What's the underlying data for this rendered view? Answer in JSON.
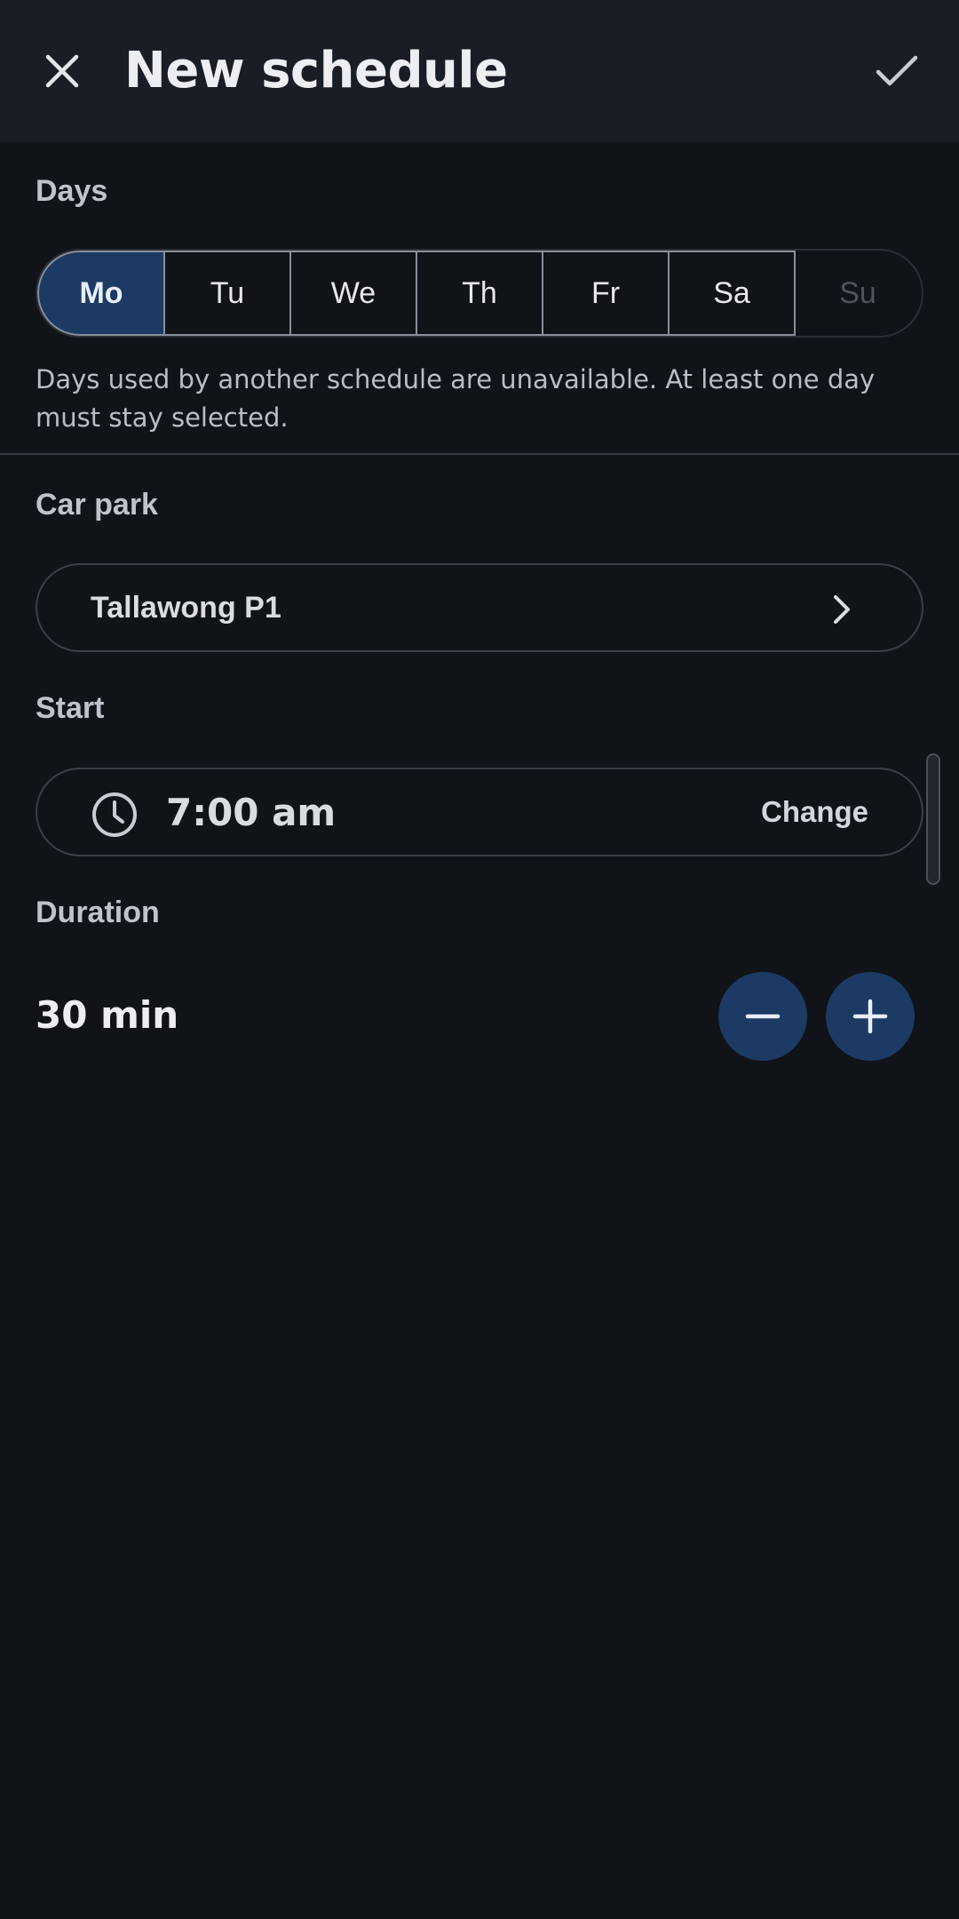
{
  "header": {
    "title": "New schedule",
    "close_icon": "close-icon",
    "confirm_icon": "check-icon"
  },
  "days": {
    "label": "Days",
    "items": [
      {
        "label": "Mo",
        "state": "selected"
      },
      {
        "label": "Tu",
        "state": "available"
      },
      {
        "label": "We",
        "state": "available"
      },
      {
        "label": "Th",
        "state": "available"
      },
      {
        "label": "Fr",
        "state": "available"
      },
      {
        "label": "Sa",
        "state": "available"
      },
      {
        "label": "Su",
        "state": "unavailable"
      }
    ],
    "hint": "Days used by another schedule are unavailable. At least one day must stay selected."
  },
  "carpark": {
    "label": "Car park",
    "value": "Tallawong P1",
    "icon": "chevron-right-icon"
  },
  "start": {
    "label": "Start",
    "time": "7:00 am",
    "action": "Change",
    "icon": "clock-icon"
  },
  "duration": {
    "label": "Duration",
    "value": "30 min",
    "decrease_icon": "minus-icon",
    "increase_icon": "plus-icon"
  },
  "colors": {
    "background": "#101318",
    "app_bar": "#191e26",
    "accent": "#1c3a63",
    "outline": "#3b4048"
  }
}
